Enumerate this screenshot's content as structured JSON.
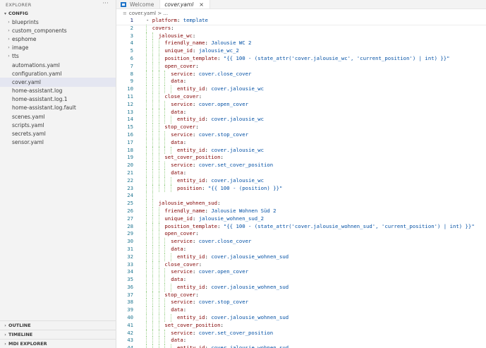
{
  "explorer": {
    "title": "EXPLORER",
    "more": "···",
    "folder": "CONFIG",
    "items": [
      {
        "label": "blueprints",
        "type": "folder"
      },
      {
        "label": "custom_components",
        "type": "folder"
      },
      {
        "label": "esphome",
        "type": "folder"
      },
      {
        "label": "image",
        "type": "folder"
      },
      {
        "label": "tts",
        "type": "folder"
      },
      {
        "label": "automations.yaml",
        "type": "file"
      },
      {
        "label": "configuration.yaml",
        "type": "file"
      },
      {
        "label": "cover.yaml",
        "type": "file",
        "selected": true
      },
      {
        "label": "home-assistant.log",
        "type": "file"
      },
      {
        "label": "home-assistant.log.1",
        "type": "file"
      },
      {
        "label": "home-assistant.log.fault",
        "type": "file"
      },
      {
        "label": "scenes.yaml",
        "type": "file"
      },
      {
        "label": "scripts.yaml",
        "type": "file"
      },
      {
        "label": "secrets.yaml",
        "type": "file"
      },
      {
        "label": "sensor.yaml",
        "type": "file"
      }
    ],
    "bottom": [
      "OUTLINE",
      "TIMELINE",
      "MDI EXPLORER"
    ]
  },
  "tabs": [
    {
      "label": "Welcome",
      "active": false
    },
    {
      "label": "cover.yaml",
      "active": true,
      "close": "×"
    }
  ],
  "breadcrumb": "cover.yaml > ...",
  "code": [
    {
      "n": "1",
      "i": 0,
      "t": [
        [
          "p",
          "- "
        ],
        [
          "k",
          "platform"
        ],
        [
          "p",
          ": "
        ],
        [
          "s",
          "template"
        ]
      ],
      "current": true
    },
    {
      "n": "2",
      "i": 1,
      "t": [
        [
          "k",
          "covers"
        ],
        [
          "p",
          ":"
        ]
      ]
    },
    {
      "n": "3",
      "i": 2,
      "t": [
        [
          "k",
          "jalousie_wc"
        ],
        [
          "p",
          ":"
        ]
      ]
    },
    {
      "n": "4",
      "i": 3,
      "t": [
        [
          "k",
          "friendly_name"
        ],
        [
          "p",
          ": "
        ],
        [
          "s",
          "Jalousie WC 2"
        ]
      ]
    },
    {
      "n": "5",
      "i": 3,
      "t": [
        [
          "k",
          "unique_id"
        ],
        [
          "p",
          ": "
        ],
        [
          "s",
          "jalousie_wc_2"
        ]
      ]
    },
    {
      "n": "6",
      "i": 3,
      "t": [
        [
          "k",
          "position_template"
        ],
        [
          "p",
          ": "
        ],
        [
          "s",
          "\"{{ 100 - (state_attr('cover.jalousie_wc', 'current_position') | int) }}\""
        ]
      ]
    },
    {
      "n": "7",
      "i": 3,
      "t": [
        [
          "k",
          "open_cover"
        ],
        [
          "p",
          ":"
        ]
      ]
    },
    {
      "n": "8",
      "i": 4,
      "t": [
        [
          "k",
          "service"
        ],
        [
          "p",
          ": "
        ],
        [
          "s",
          "cover.close_cover"
        ]
      ]
    },
    {
      "n": "9",
      "i": 4,
      "t": [
        [
          "k",
          "data"
        ],
        [
          "p",
          ":"
        ]
      ]
    },
    {
      "n": "10",
      "i": 5,
      "t": [
        [
          "k",
          "entity_id"
        ],
        [
          "p",
          ": "
        ],
        [
          "s",
          "cover.jalousie_wc"
        ]
      ]
    },
    {
      "n": "11",
      "i": 3,
      "t": [
        [
          "k",
          "close_cover"
        ],
        [
          "p",
          ":"
        ]
      ]
    },
    {
      "n": "12",
      "i": 4,
      "t": [
        [
          "k",
          "service"
        ],
        [
          "p",
          ": "
        ],
        [
          "s",
          "cover.open_cover"
        ]
      ]
    },
    {
      "n": "13",
      "i": 4,
      "t": [
        [
          "k",
          "data"
        ],
        [
          "p",
          ":"
        ]
      ]
    },
    {
      "n": "14",
      "i": 5,
      "t": [
        [
          "k",
          "entity_id"
        ],
        [
          "p",
          ": "
        ],
        [
          "s",
          "cover.jalousie_wc"
        ]
      ]
    },
    {
      "n": "15",
      "i": 3,
      "t": [
        [
          "k",
          "stop_cover"
        ],
        [
          "p",
          ":"
        ]
      ]
    },
    {
      "n": "16",
      "i": 4,
      "t": [
        [
          "k",
          "service"
        ],
        [
          "p",
          ": "
        ],
        [
          "s",
          "cover.stop_cover"
        ]
      ]
    },
    {
      "n": "17",
      "i": 4,
      "t": [
        [
          "k",
          "data"
        ],
        [
          "p",
          ":"
        ]
      ]
    },
    {
      "n": "18",
      "i": 5,
      "t": [
        [
          "k",
          "entity_id"
        ],
        [
          "p",
          ": "
        ],
        [
          "s",
          "cover.jalousie_wc"
        ]
      ]
    },
    {
      "n": "19",
      "i": 3,
      "t": [
        [
          "k",
          "set_cover_position"
        ],
        [
          "p",
          ":"
        ]
      ]
    },
    {
      "n": "20",
      "i": 4,
      "t": [
        [
          "k",
          "service"
        ],
        [
          "p",
          ": "
        ],
        [
          "s",
          "cover.set_cover_position"
        ]
      ]
    },
    {
      "n": "21",
      "i": 4,
      "t": [
        [
          "k",
          "data"
        ],
        [
          "p",
          ":"
        ]
      ]
    },
    {
      "n": "22",
      "i": 5,
      "t": [
        [
          "k",
          "entity_id"
        ],
        [
          "p",
          ": "
        ],
        [
          "s",
          "cover.jalousie_wc"
        ]
      ]
    },
    {
      "n": "23",
      "i": 5,
      "t": [
        [
          "k",
          "position"
        ],
        [
          "p",
          ": "
        ],
        [
          "s",
          "\"{{ 100 - (position) }}\""
        ]
      ]
    },
    {
      "n": "24",
      "i": 2,
      "t": []
    },
    {
      "n": "25",
      "i": 2,
      "t": [
        [
          "k",
          "jalousie_wohnen_sud"
        ],
        [
          "p",
          ":"
        ]
      ]
    },
    {
      "n": "26",
      "i": 3,
      "t": [
        [
          "k",
          "friendly_name"
        ],
        [
          "p",
          ": "
        ],
        [
          "s",
          "Jalousie Wohnen Süd 2"
        ]
      ]
    },
    {
      "n": "27",
      "i": 3,
      "t": [
        [
          "k",
          "unique_id"
        ],
        [
          "p",
          ": "
        ],
        [
          "s",
          "jalousie_wohnen_sud_2"
        ]
      ]
    },
    {
      "n": "28",
      "i": 3,
      "t": [
        [
          "k",
          "position_template"
        ],
        [
          "p",
          ": "
        ],
        [
          "s",
          "\"{{ 100 - (state_attr('cover.jalousie_wohnen_sud', 'current_position') | int) }}\""
        ]
      ]
    },
    {
      "n": "29",
      "i": 3,
      "t": [
        [
          "k",
          "open_cover"
        ],
        [
          "p",
          ":"
        ]
      ]
    },
    {
      "n": "30",
      "i": 4,
      "t": [
        [
          "k",
          "service"
        ],
        [
          "p",
          ": "
        ],
        [
          "s",
          "cover.close_cover"
        ]
      ]
    },
    {
      "n": "31",
      "i": 4,
      "t": [
        [
          "k",
          "data"
        ],
        [
          "p",
          ":"
        ]
      ]
    },
    {
      "n": "32",
      "i": 5,
      "t": [
        [
          "k",
          "entity_id"
        ],
        [
          "p",
          ": "
        ],
        [
          "s",
          "cover.jalousie_wohnen_sud"
        ]
      ]
    },
    {
      "n": "33",
      "i": 3,
      "t": [
        [
          "k",
          "close_cover"
        ],
        [
          "p",
          ":"
        ]
      ]
    },
    {
      "n": "34",
      "i": 4,
      "t": [
        [
          "k",
          "service"
        ],
        [
          "p",
          ": "
        ],
        [
          "s",
          "cover.open_cover"
        ]
      ]
    },
    {
      "n": "35",
      "i": 4,
      "t": [
        [
          "k",
          "data"
        ],
        [
          "p",
          ":"
        ]
      ]
    },
    {
      "n": "36",
      "i": 5,
      "t": [
        [
          "k",
          "entity_id"
        ],
        [
          "p",
          ": "
        ],
        [
          "s",
          "cover.jalousie_wohnen_sud"
        ]
      ]
    },
    {
      "n": "37",
      "i": 3,
      "t": [
        [
          "k",
          "stop_cover"
        ],
        [
          "p",
          ":"
        ]
      ]
    },
    {
      "n": "38",
      "i": 4,
      "t": [
        [
          "k",
          "service"
        ],
        [
          "p",
          ": "
        ],
        [
          "s",
          "cover.stop_cover"
        ]
      ]
    },
    {
      "n": "39",
      "i": 4,
      "t": [
        [
          "k",
          "data"
        ],
        [
          "p",
          ":"
        ]
      ]
    },
    {
      "n": "40",
      "i": 5,
      "t": [
        [
          "k",
          "entity_id"
        ],
        [
          "p",
          ": "
        ],
        [
          "s",
          "cover.jalousie_wohnen_sud"
        ]
      ]
    },
    {
      "n": "41",
      "i": 3,
      "t": [
        [
          "k",
          "set_cover_position"
        ],
        [
          "p",
          ":"
        ]
      ]
    },
    {
      "n": "42",
      "i": 4,
      "t": [
        [
          "k",
          "service"
        ],
        [
          "p",
          ": "
        ],
        [
          "s",
          "cover.set_cover_position"
        ]
      ]
    },
    {
      "n": "43",
      "i": 4,
      "t": [
        [
          "k",
          "data"
        ],
        [
          "p",
          ":"
        ]
      ]
    },
    {
      "n": "44",
      "i": 5,
      "t": [
        [
          "k",
          "entity_id"
        ],
        [
          "p",
          ": "
        ],
        [
          "s",
          "cover.jalousie_wohnen_sud"
        ]
      ]
    }
  ]
}
